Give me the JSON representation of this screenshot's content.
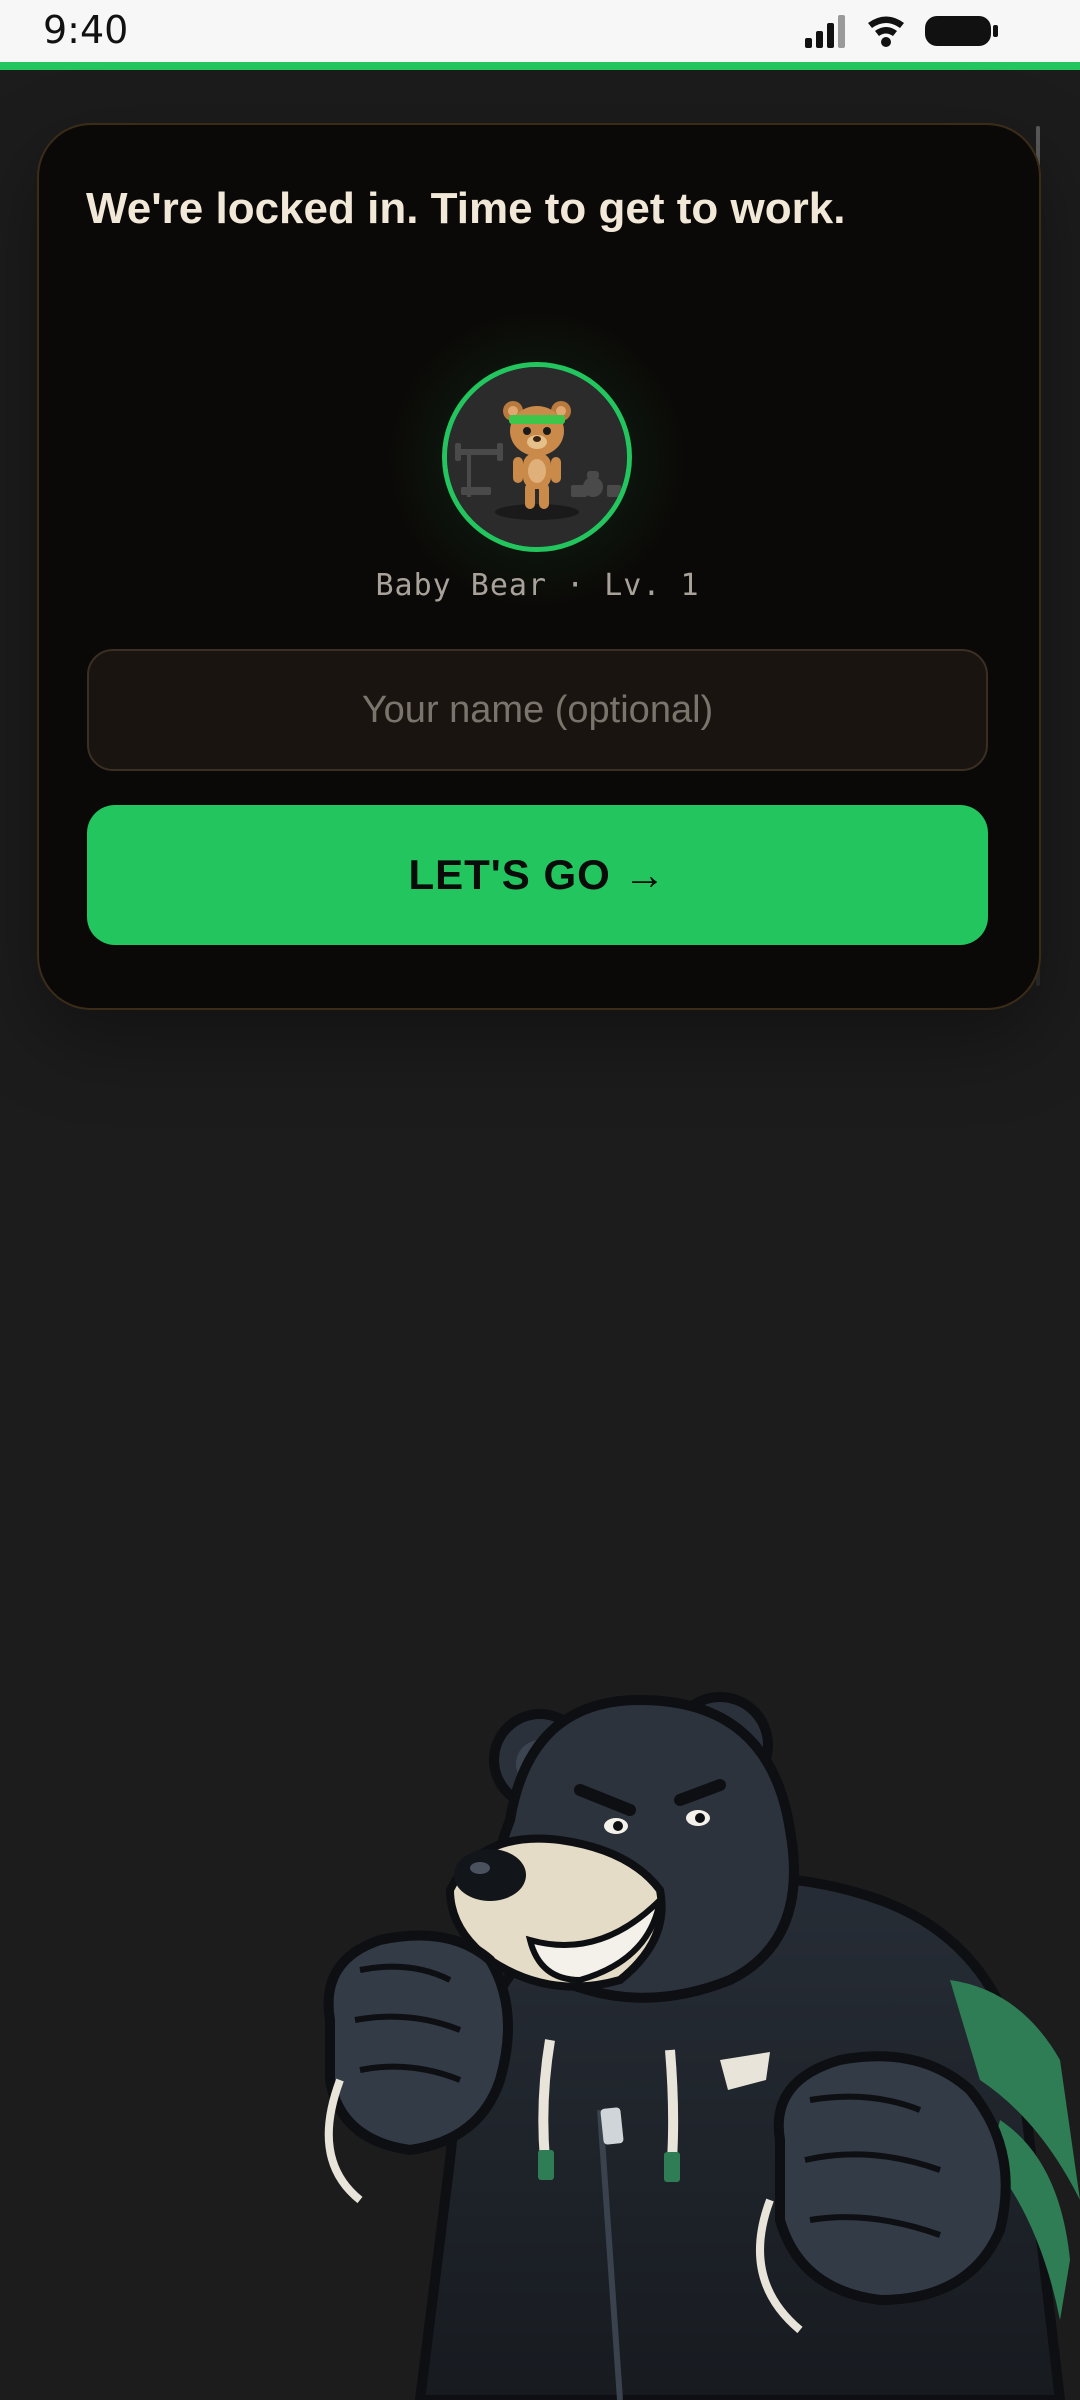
{
  "status_bar": {
    "time": "9:40",
    "icons": [
      "signal-icon",
      "wifi-icon",
      "battery-icon"
    ]
  },
  "card": {
    "headline": "We're locked in. Time to get to work.",
    "avatar": {
      "icon": "baby-bear-avatar-icon",
      "rank_label": "Baby Bear · Lv. 1"
    },
    "name_input": {
      "value": "",
      "placeholder": "Your name (optional)"
    },
    "cta_label": "LET'S GO →"
  },
  "mascot": {
    "icon": "bear-mascot-illustration"
  },
  "colors": {
    "accent": "#22c55e",
    "background": "#1c1c1c",
    "card_background": "#0b0907",
    "card_border": "#3b2c18",
    "headline_text": "#f1e8d8",
    "muted_text": "#a8a29a"
  }
}
